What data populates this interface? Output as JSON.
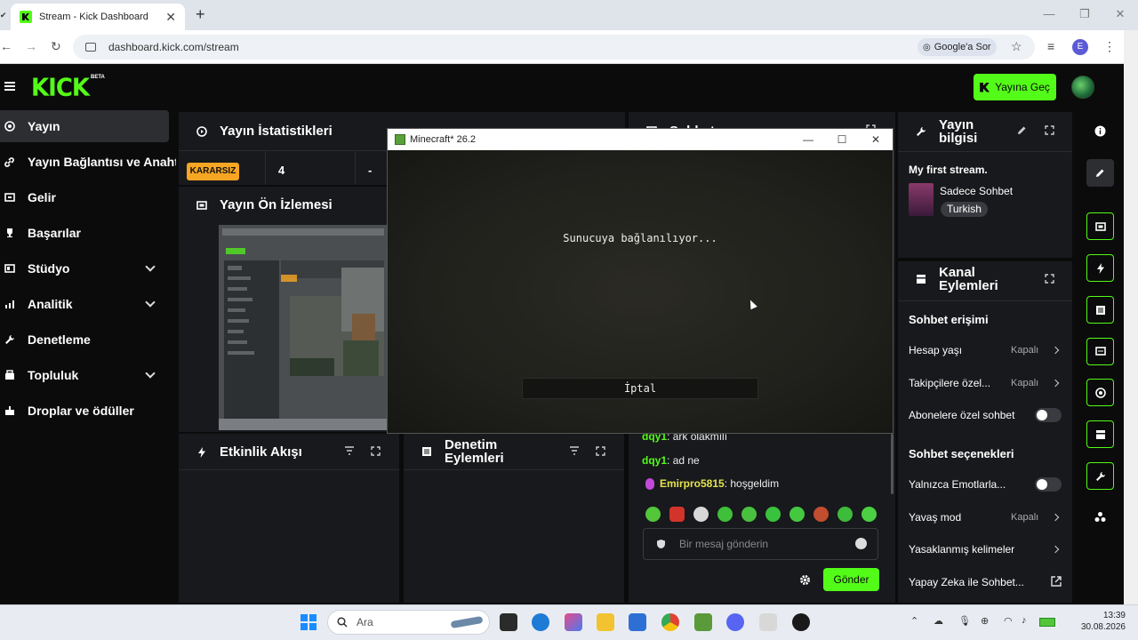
{
  "browser": {
    "tab_title": "Stream - Kick Dashboard",
    "url": "dashboard.kick.com/stream",
    "google_lens": "Google'a Sor",
    "profile_initial": "E"
  },
  "header": {
    "logo": "KICK",
    "beta": "BETA",
    "go_live": "Yayına Geç"
  },
  "sidebar": {
    "items": [
      {
        "label": "Yayın"
      },
      {
        "label": "Yayın Bağlantısı ve Anahtarı"
      },
      {
        "label": "Gelir"
      },
      {
        "label": "Başarılar"
      },
      {
        "label": "Stüdyo"
      },
      {
        "label": "Analitik"
      },
      {
        "label": "Denetleme"
      },
      {
        "label": "Topluluk"
      },
      {
        "label": "Droplar ve ödüller"
      }
    ]
  },
  "stats": {
    "title": "Yayın İstatistikleri",
    "status_badge": "KARARSIZ",
    "viewers": "4",
    "duration": "-"
  },
  "preview": {
    "title": "Yayın Ön İzlemesi"
  },
  "activity": {
    "title": "Etkinlik Akışı"
  },
  "mod_actions": {
    "title": "Denetim Eylemleri"
  },
  "chat": {
    "title": "Sohbet",
    "messages": [
      {
        "user": "dqy1",
        "text": "ark olakmılı"
      },
      {
        "user": "dqy1",
        "text": "ad ne"
      },
      {
        "user": "Emirpro5815",
        "text": "hoşgeldim"
      }
    ],
    "input_placeholder": "Bir mesaj gönderin",
    "send": "Gönder"
  },
  "stream_info": {
    "title": "Yayın bilgisi",
    "stream_title": "My first stream.",
    "category": "Sadece Sohbet",
    "language": "Turkish"
  },
  "channel_actions": {
    "title": "Kanal Eylemleri",
    "chat_access_heading": "Sohbet erişimi",
    "account_age": {
      "label": "Hesap yaşı",
      "value": "Kapalı"
    },
    "followers_only": {
      "label": "Takipçilere özel...",
      "value": "Kapalı"
    },
    "subscribers_only": {
      "label": "Abonelere özel sohbet"
    },
    "chat_options_heading": "Sohbet seçenekleri",
    "emotes_only": {
      "label": "Yalnızca Emotlarla..."
    },
    "slow_mode": {
      "label": "Yavaş mod",
      "value": "Kapalı"
    },
    "banned_words": {
      "label": "Yasaklanmış kelimeler"
    },
    "ai_chat": {
      "label": "Yapay Zeka ile Sohbet..."
    }
  },
  "minecraft": {
    "window_title": "Minecraft* 26.2",
    "status": "Sunucuya bağlanılıyor...",
    "cancel": "İptal"
  },
  "taskbar": {
    "search_placeholder": "Ara",
    "time": "13:39",
    "date": "30.08.2026"
  },
  "colors": {
    "accent": "#53fc18",
    "warning": "#f6a623",
    "panel": "#18191c",
    "background": "#0b0b0c"
  }
}
